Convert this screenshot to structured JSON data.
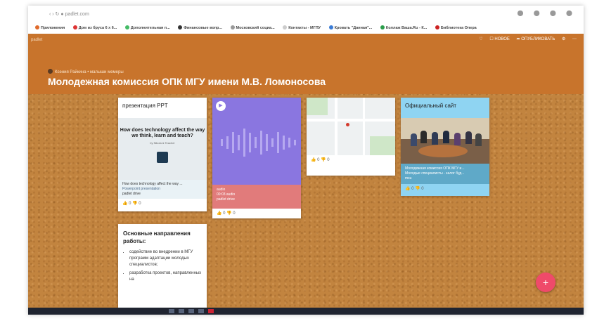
{
  "browser": {
    "bookmarks": [
      "Приложения",
      "Дом из бруса 6 х 6...",
      "Дополнительная п...",
      "Финансовые вопр...",
      "Московский социа...",
      "Контакты - МГПУ",
      "Кровать \"Данная\"...",
      "Коллаж Ваша.Ru - К...",
      "Библиотека Опера"
    ]
  },
  "header": {
    "breadcrumb": "Ксения Райкина • малыши мемеры",
    "title": "Молодежная комиссия ОПК МГУ имени М.В. Ломоносова",
    "actions": [
      "♡",
      "☐ НОВОЕ",
      "➦ ОПУБЛИКОВАТЬ",
      "⚙",
      "⋯"
    ]
  },
  "cards": {
    "ppt": {
      "title": "презентация PPT",
      "slide_title": "How does technology affect the way we think, learn and teach?",
      "slide_author": "by Nikola & Teacher",
      "meta_title": "How does technology affect the way ...",
      "meta_type": "Powerpoint presentation",
      "meta_source": "padlet drive",
      "likes": "👍 0 👎 0"
    },
    "audio": {
      "meta_title": "audio",
      "meta_duration": "00:03 audio",
      "meta_source": "padlet drive",
      "likes": "👍 0 👎 0"
    },
    "map": {
      "likes": "👍 0 👎 0"
    },
    "site": {
      "title": "Официальный сайт",
      "meta_title": "Молодежная комиссия ОПК МГУ и...",
      "meta_desc": "Молодые специалисты - залог буд...",
      "meta_source": "msu",
      "likes": "👍 0 👎 0"
    },
    "text": {
      "title": "Основные направления работы:",
      "items": [
        "содействие во внедрении в МГУ программ адаптации молодых специалистов;",
        "разработка проектов, направленных на"
      ]
    }
  },
  "fab": "+"
}
